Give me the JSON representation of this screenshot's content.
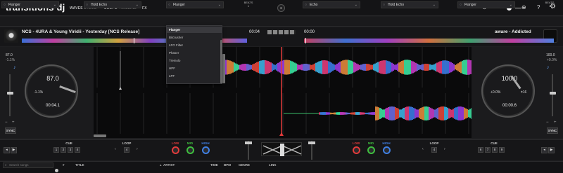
{
  "app": {
    "title": "transitions dj"
  },
  "nav": {
    "waves": "WAVES",
    "stems": "STEMS",
    "scope": "SCOPE",
    "timeline": "TIMELINE",
    "fx": "FX"
  },
  "fxbar": {
    "deck_a_fx1": "Flanger",
    "deck_a_fx2": "Hold Echo",
    "deck_a_fx3": "Flanger",
    "deck_b_fx1": "Echo",
    "deck_b_fx2": "Hold Echo",
    "deck_b_fx3": "Flanger",
    "beats_label": "BEATS",
    "beats_value": "1"
  },
  "deck_a": {
    "track_title": "NCS - 4URA & Young Viridii - Yesterday [NCS Release]",
    "time": "00:04",
    "bpm": "87.0",
    "pitch": "-1.1%",
    "jog_bpm": "87.0",
    "jog_pitch": "-1.1%",
    "jog_time": "00:04.1",
    "sync": "SYNC",
    "cue": "CUE",
    "loop": "LOOP",
    "loop_value": "4",
    "cue_pads": [
      "1",
      "2",
      "3",
      "4"
    ],
    "eq_low": "LOW",
    "eq_mid": "MID",
    "eq_high": "HIGH"
  },
  "deck_b": {
    "track_title": "aware - Addicted",
    "time": "00:00",
    "bpm": "100.0",
    "pitch": "+0.0%",
    "jog_bpm": "100.0",
    "jog_pitch": "+0.0%",
    "jog_range": "±16",
    "jog_time": "00:00.6",
    "sync": "SYNC",
    "cue": "CUE",
    "loop": "LOOP",
    "loop_value": "4",
    "cue_pads": [
      "6",
      "7",
      "8",
      "9"
    ],
    "eq_low": "LOW",
    "eq_mid": "MID",
    "eq_high": "HIGH"
  },
  "fx_dropdown": {
    "items": [
      "Flanger",
      "Bitcrusher",
      "LFO Filter",
      "Phaser",
      "Tremolo",
      "HPF",
      "LPF"
    ],
    "selected": "Flanger"
  },
  "library": {
    "search_placeholder": "Search songs",
    "columns": {
      "num": "#",
      "title": "TITLE",
      "artist": "ARTIST",
      "time": "TIME",
      "bpm": "BPM",
      "genre": "GENRE",
      "link": "LINK"
    }
  },
  "colors": {
    "accent_red": "#e23b3b",
    "eq_low": "#e23b3b",
    "eq_mid": "#3fbf3f",
    "eq_high": "#3f7fe2",
    "bpm_blue": "#6aa9ff"
  }
}
